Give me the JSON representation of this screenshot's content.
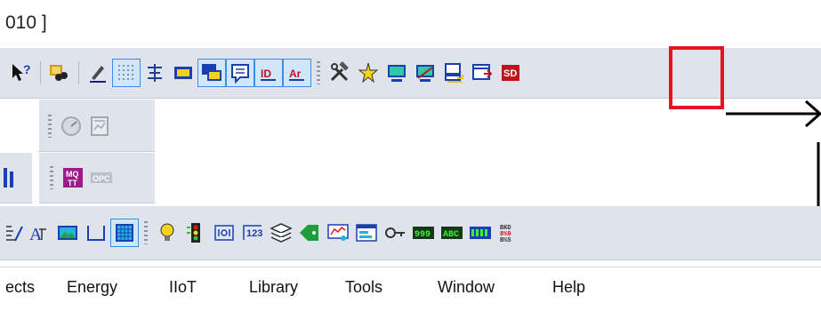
{
  "window": {
    "title_fragment": "010 ]"
  },
  "toolbar_row1": {
    "icons": [
      "help-pointer-icon",
      "find-icon",
      "pen-icon",
      "grid-icon",
      "align-icon",
      "rectangle-icon",
      "overlap-icon",
      "comment-icon",
      "id-icon",
      "label-icon",
      "tools-icon",
      "star-tool-icon",
      "screen-icon",
      "screen-run-icon",
      "screen-export-icon",
      "screen-window-icon",
      "sd-card-icon"
    ]
  },
  "toolbar_row2": {
    "icons": [
      "gauge-icon",
      "panel-icon"
    ]
  },
  "toolbar_row3": {
    "icons": [
      "level-icon",
      "mqtt-icon",
      "opc-icon"
    ],
    "mqtt_label": "MQ\nTT",
    "opc_label": "OPC"
  },
  "toolbar_row4": {
    "icons": [
      "scale-icon",
      "text-icon",
      "image-icon",
      "bracket-icon",
      "table-grid-icon",
      "bulb-icon",
      "traffic-light-icon",
      "switch-icon",
      "number-icon",
      "layers-icon",
      "arrow-tag-icon",
      "chart-screen-icon",
      "display-icon",
      "key-icon",
      "numeric-display-icon",
      "text-display-icon",
      "bar-display-icon",
      "code-icon"
    ],
    "numeric_display_text": "999",
    "text_display_text": "ABC"
  },
  "menu": {
    "items": [
      {
        "label": "ects",
        "access": ""
      },
      {
        "label": "Energy",
        "access": "n"
      },
      {
        "label": "IIoT",
        "access": "I"
      },
      {
        "label": "Library",
        "access": "L"
      },
      {
        "label": "Tools",
        "access": "T"
      },
      {
        "label": "Window",
        "access": "W"
      },
      {
        "label": "Help",
        "access": "H"
      }
    ]
  },
  "colors": {
    "highlight": "#e8141b",
    "toolbar_band": "#dfe4ec",
    "active_button": "#cfe6fb"
  }
}
